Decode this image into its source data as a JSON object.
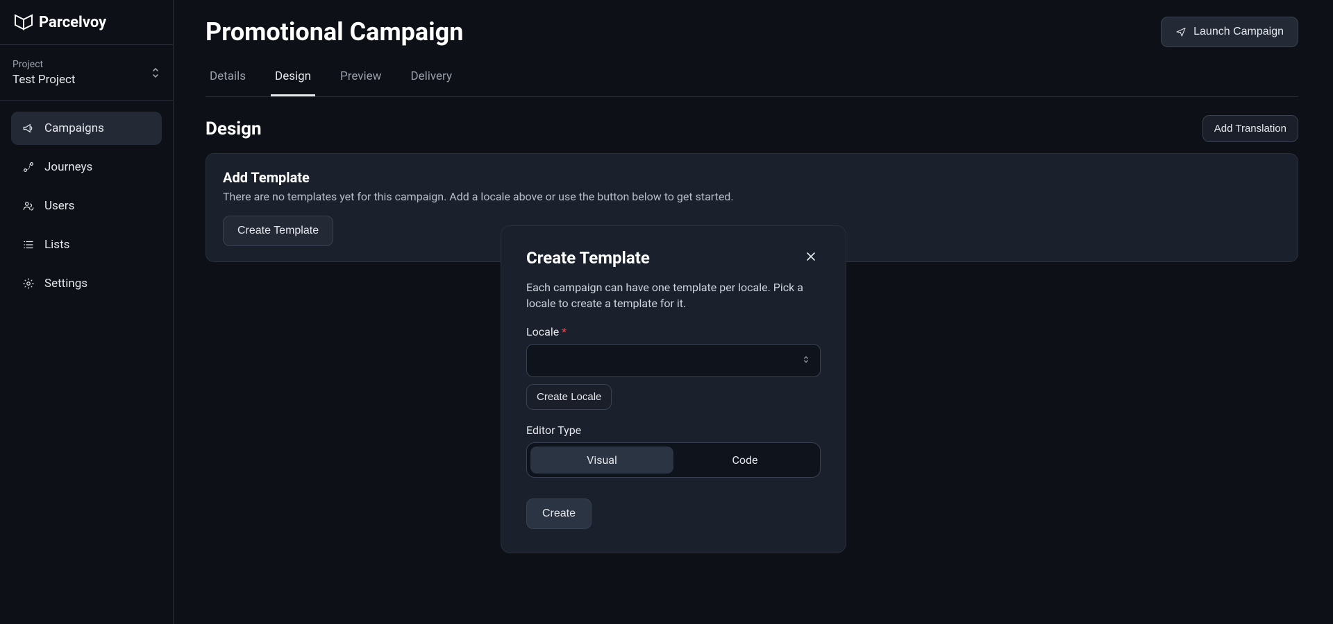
{
  "sidebar": {
    "project_label": "Project",
    "project_name": "Test Project",
    "nav": [
      {
        "label": "Campaigns",
        "active": true
      },
      {
        "label": "Journeys",
        "active": false
      },
      {
        "label": "Users",
        "active": false
      },
      {
        "label": "Lists",
        "active": false
      },
      {
        "label": "Settings",
        "active": false
      }
    ]
  },
  "header": {
    "title": "Promotional Campaign",
    "launch_label": "Launch Campaign"
  },
  "tabs": [
    {
      "label": "Details",
      "active": false
    },
    {
      "label": "Design",
      "active": true
    },
    {
      "label": "Preview",
      "active": false
    },
    {
      "label": "Delivery",
      "active": false
    }
  ],
  "section": {
    "title": "Design",
    "add_translation_label": "Add Translation"
  },
  "panel": {
    "heading": "Add Template",
    "body": "There are no templates yet for this campaign. Add a locale above or use the button below to get started.",
    "create_template_label": "Create Template"
  },
  "modal": {
    "title": "Create Template",
    "description": "Each campaign can have one template per locale. Pick a locale to create a template for it.",
    "locale_label": "Locale",
    "locale_value": "",
    "create_locale_label": "Create Locale",
    "editor_type_label": "Editor Type",
    "editor_options": {
      "visual": "Visual",
      "code": "Code"
    },
    "submit_label": "Create"
  }
}
